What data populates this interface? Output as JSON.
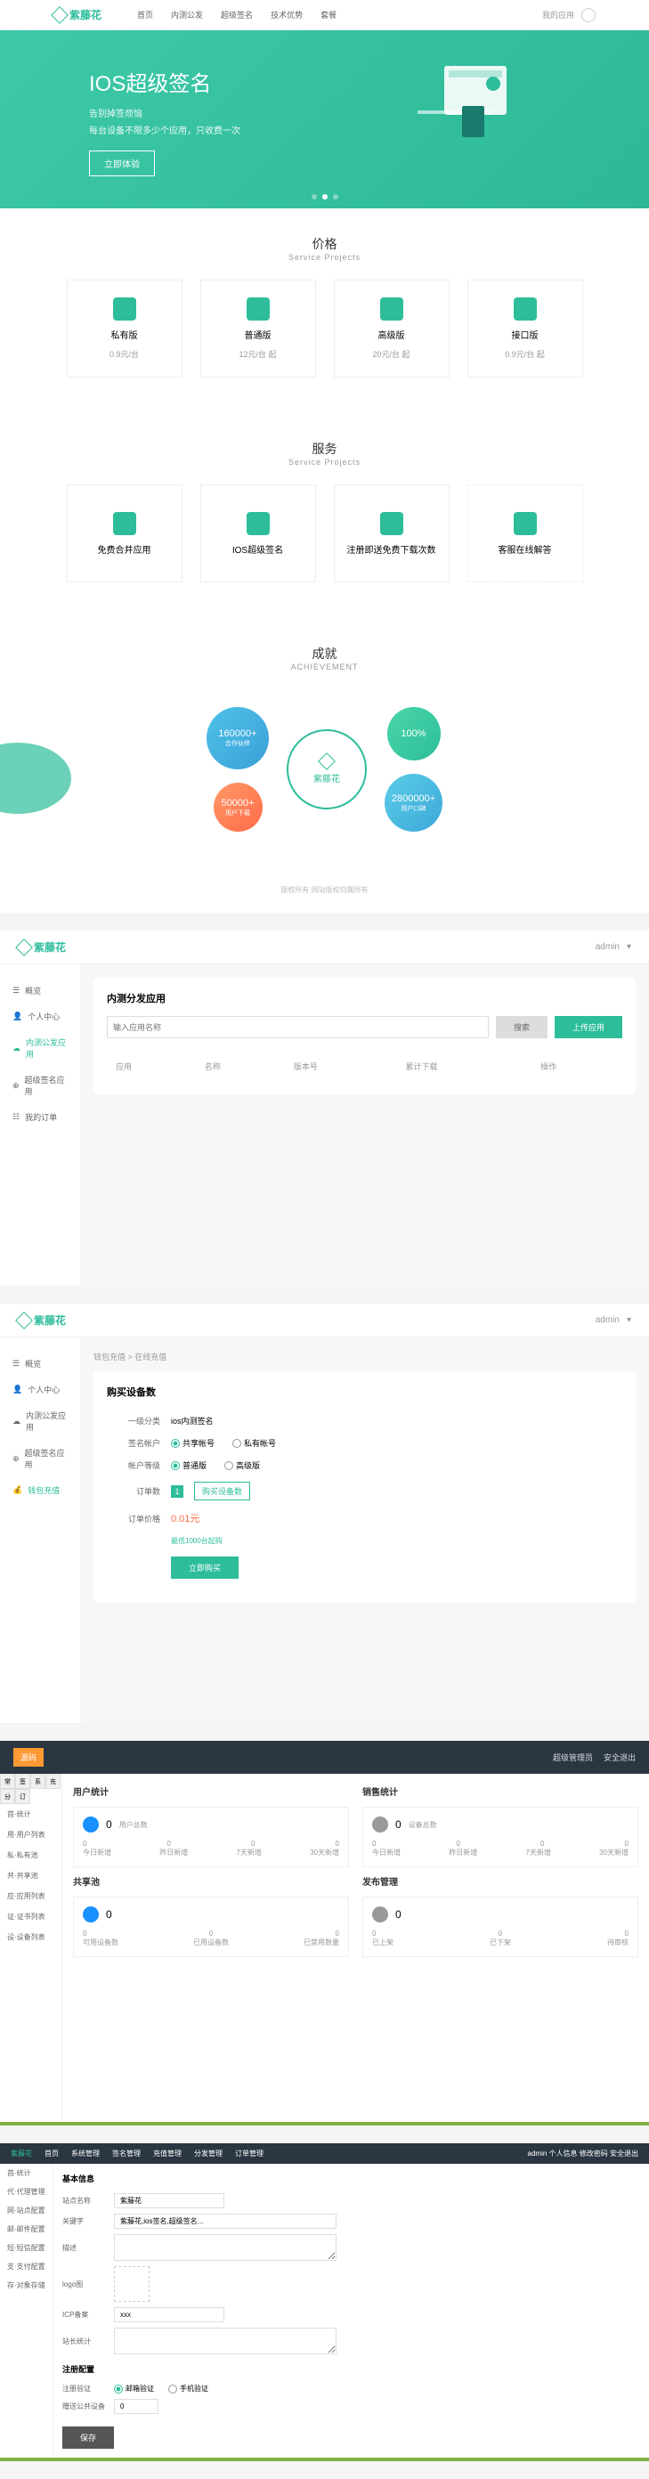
{
  "s1": {
    "logo": "紫藤花",
    "nav": [
      "首页",
      "内测公发",
      "超级签名",
      "技术优势",
      "套餐"
    ],
    "login": "我的应用",
    "hero": {
      "title": "IOS超级签名",
      "line1": "告别掉签烦恼",
      "line2": "每台设备不限多少个应用，只收费一次",
      "btn": "立即体验"
    },
    "price": {
      "title": "价格",
      "sub": "Service Projects",
      "items": [
        {
          "name": "私有版",
          "price": "0.9元/台"
        },
        {
          "name": "普通版",
          "price": "12元/台 起"
        },
        {
          "name": "高级版",
          "price": "20元/台 起"
        },
        {
          "name": "接口版",
          "price": "0.9元/台 起"
        }
      ]
    },
    "service": {
      "title": "服务",
      "sub": "Service Projects",
      "items": [
        "免费合并应用",
        "IOS超级签名",
        "注册即送免费下载次数",
        "客服在线解答"
      ]
    },
    "ach": {
      "title": "成就",
      "sub": "ACHIEVEMENT",
      "c1": {
        "n": "160000+",
        "l": "合作伙伴"
      },
      "c2": {
        "n": "100%",
        "l": ""
      },
      "c3": {
        "n": "50000+",
        "l": "用户下载"
      },
      "c4": {
        "n": "2800000+",
        "l": "用户口碑"
      },
      "center": "紫藤花"
    },
    "footer": "版权所有 网站版权归属所有"
  },
  "s2": {
    "logo": "紫藤花",
    "user": "admin",
    "sidebar": [
      "概览",
      "个人中心",
      "内测公发应用",
      "超级签名应用",
      "我的订单"
    ],
    "title": "内测分发应用",
    "searchPh": "输入应用名称",
    "btnSearch": "搜索",
    "btnUpload": "上传应用",
    "cols": [
      "应用",
      "名称",
      "版本号",
      "累计下载",
      "操作"
    ]
  },
  "s3": {
    "logo": "紫藤花",
    "user": "admin",
    "sidebar": [
      "概览",
      "个人中心",
      "内测公发应用",
      "超级签名应用",
      "钱包充值"
    ],
    "crumb": "钱包充值 > 在线充值",
    "title": "购买设备数",
    "rows": {
      "type": {
        "label": "一级分类",
        "val": "ios内测签名"
      },
      "acct": {
        "label": "签名帐户",
        "opts": [
          "共享帐号",
          "私有帐号"
        ]
      },
      "level": {
        "label": "帐户等级",
        "opts": [
          "普通版",
          "高级版"
        ]
      },
      "qty": {
        "label": "订单数",
        "tag": "购买设备数"
      },
      "price": {
        "label": "订单价格",
        "val": "0.01元",
        "hint": "最低1000台起购"
      }
    },
    "btn": "立即购买"
  },
  "s4": {
    "logo": "源码",
    "headerRight": [
      "超级管理员",
      "安全退出"
    ],
    "sbTabs": [
      "常",
      "签",
      "系",
      "充",
      "分",
      "订"
    ],
    "sidebar": [
      "首·统计",
      "用·用户列表",
      "私·私有池",
      "共·共享池",
      "应·应用列表",
      "证·证书列表",
      "设·设备列表"
    ],
    "cols": [
      {
        "title": "用户统计",
        "card1": {
          "n": "0",
          "l": "用户总数",
          "stats": [
            "0",
            "0",
            "0",
            "0"
          ],
          "labels": [
            "今日新增",
            "昨日新增",
            "7天新增",
            "30天新增"
          ]
        },
        "title2": "共享池",
        "card2": {
          "n": "0",
          "stats": [
            "0",
            "0",
            "0"
          ],
          "labels": [
            "可用设备数",
            "已用设备数",
            "已禁用数量"
          ]
        }
      },
      {
        "title": "销售统计",
        "card1": {
          "n": "0",
          "l": "设备总数",
          "stats": [
            "0",
            "0",
            "0",
            "0"
          ],
          "labels": [
            "今日新增",
            "昨日新增",
            "7天新增",
            "30天新增"
          ]
        },
        "title2": "发布管理",
        "card2": {
          "n": "0",
          "stats": [
            "0",
            "0",
            "0"
          ],
          "labels": [
            "已上架",
            "已下架",
            "待审核"
          ]
        }
      }
    ]
  },
  "s5": {
    "logo": "紫藤花",
    "tabs": [
      "首页",
      "系统管理",
      "签名管理",
      "充值管理",
      "分发管理",
      "订单管理"
    ],
    "user": "admin 个人信息 修改密码 安全退出",
    "sidebar": [
      "首·统计",
      "代·代理管理",
      "网·站点配置",
      "邮·邮件配置",
      "短·短信配置",
      "支·支付配置",
      "存·对象存储"
    ],
    "title": "基本信息",
    "fields": [
      {
        "label": "站点名称",
        "val": "紫藤花"
      },
      {
        "label": "关键字",
        "val": "紫藤花,ios签名,超级签名..."
      },
      {
        "label": "描述",
        "val": ""
      },
      {
        "label": "logo图",
        "val": ""
      },
      {
        "label": "ICP备案",
        "val": "xxx"
      },
      {
        "label": "站长统计",
        "val": ""
      }
    ],
    "title2": "注册配置",
    "fields2": [
      {
        "label": "注册验证",
        "opts": [
          "邮箱验证",
          "手机验证"
        ]
      },
      {
        "label": "赠送公共设备",
        "val": "0"
      }
    ],
    "btn": "保存"
  }
}
